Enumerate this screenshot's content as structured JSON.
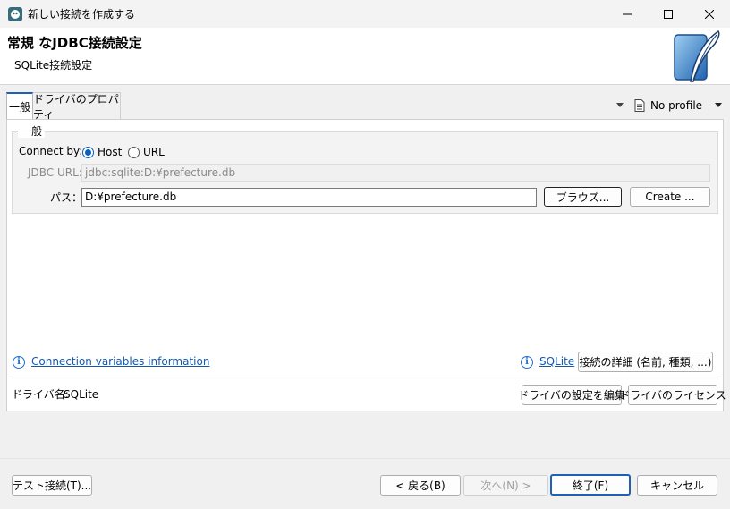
{
  "window": {
    "title": "新しい接続を作成する"
  },
  "header": {
    "title": "常規 なJDBC接続設定",
    "subtitle": "SQLite接続設定"
  },
  "tabs": [
    {
      "label": "一般",
      "active": true
    },
    {
      "label": "ドライバのプロパティ",
      "active": false
    }
  ],
  "profile": {
    "label": "No profile"
  },
  "general": {
    "legend": "一般",
    "connect_by_label": "Connect by:",
    "connect_options": [
      {
        "label": "Host",
        "selected": true
      },
      {
        "label": "URL",
        "selected": false
      }
    ],
    "jdbc_url_label": "JDBC URL:",
    "jdbc_url_value": "jdbc:sqlite:D:¥prefecture.db",
    "path_label": "パス：",
    "path_value": "D:¥prefecture.db",
    "browse_label": "ブラウズ...",
    "create_label": "Create ..."
  },
  "info": {
    "conn_vars_link": "Connection variables information",
    "sqlite_link": "SQLite",
    "details_button": "接続の詳細 (名前, 種類, ...)"
  },
  "driver": {
    "name_label": "ドライバ名:",
    "name_value": "SQLite",
    "edit_button": "ドライバの設定を編集",
    "license_button": "ドライバのライセンス"
  },
  "footer": {
    "test_button": "テスト接続(T)...",
    "back_button": "< 戻る(B)",
    "next_button": "次へ(N) >",
    "finish_button": "終了(F)",
    "cancel_button": "キャンセル"
  },
  "colors": {
    "accent": "#1f5fb7",
    "link": "#1558b0",
    "logo_blue": "#2b74c4"
  }
}
